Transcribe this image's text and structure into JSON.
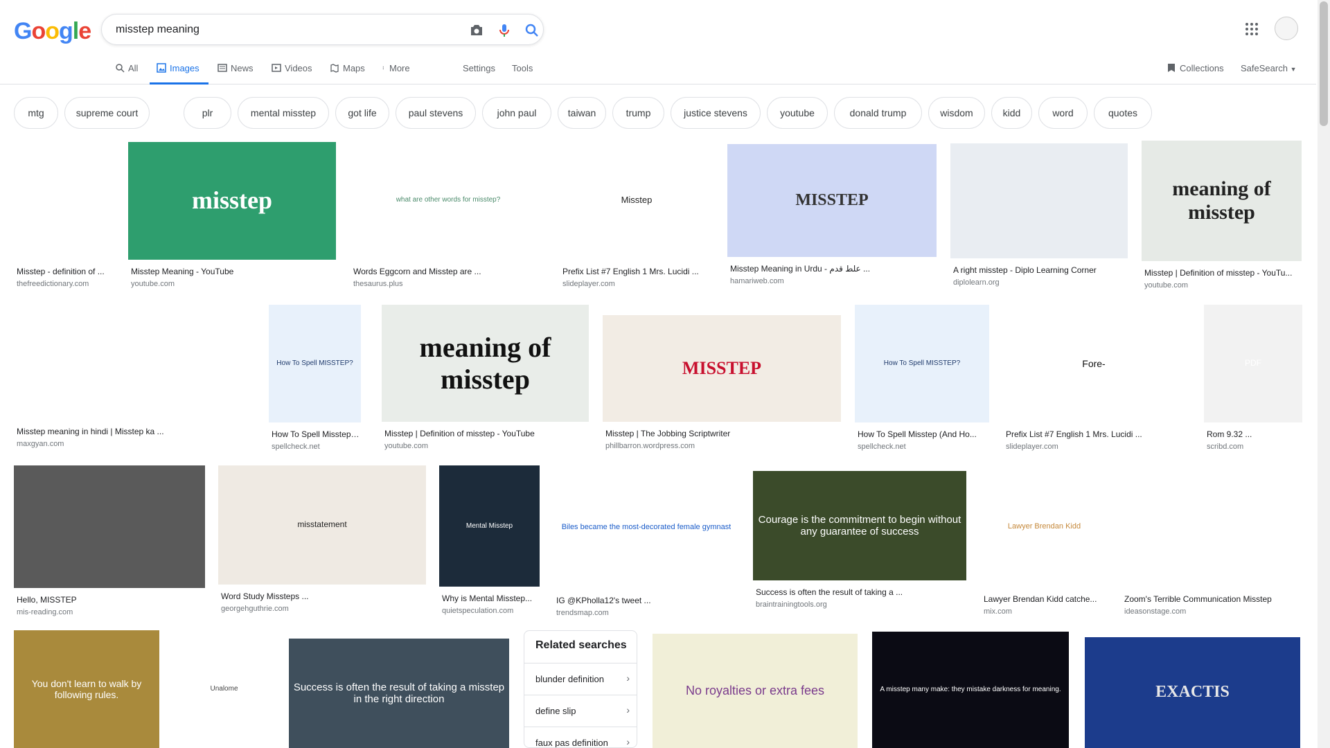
{
  "header": {
    "logo_letters": [
      "G",
      "o",
      "o",
      "g",
      "l",
      "e"
    ],
    "logo_colors": [
      "#4285f4",
      "#ea4335",
      "#fbbc05",
      "#4285f4",
      "#34a853",
      "#ea4335"
    ],
    "search_value": "misstep meaning"
  },
  "tabs": [
    {
      "label": "All",
      "icon": "search-icon"
    },
    {
      "label": "Images",
      "icon": "image-icon",
      "active": true
    },
    {
      "label": "News",
      "icon": "news-icon"
    },
    {
      "label": "Videos",
      "icon": "video-icon"
    },
    {
      "label": "Maps",
      "icon": "map-icon"
    },
    {
      "label": "More",
      "icon": "more-vert-icon"
    },
    {
      "label": "Settings"
    },
    {
      "label": "Tools"
    }
  ],
  "right_tools": {
    "collections": "Collections",
    "safesearch": "SafeSearch"
  },
  "chips": [
    "mtg",
    "supreme court",
    "plr",
    "mental misstep",
    "got life",
    "paul stevens",
    "john paul",
    "taiwan",
    "trump",
    "justice stevens",
    "youtube",
    "donald trump",
    "wisdom",
    "kidd",
    "word",
    "quotes"
  ],
  "results": [
    {
      "caption": "Misstep - definition of ...",
      "domain": "thefreedictionary.com",
      "thumb_text": ""
    },
    {
      "caption": "Misstep Meaning - YouTube",
      "domain": "youtube.com",
      "thumb_text": "misstep"
    },
    {
      "caption": "Words Eggcorn and Misstep are ...",
      "domain": "thesaurus.plus",
      "thumb_text": "what are other words for misstep?"
    },
    {
      "caption": "Prefix List #7 English 1 Mrs. Lucidi ...",
      "domain": "slideplayer.com",
      "thumb_text": "Misstep"
    },
    {
      "caption": "Misstep Meaning in Urdu - علط قدم ...",
      "domain": "hamariweb.com",
      "thumb_text": "MISSTEP"
    },
    {
      "caption": "A right misstep - Diplo Learning Corner",
      "domain": "diplolearn.org",
      "thumb_text": ""
    },
    {
      "caption": "Misstep | Definition of misstep - YouTu...",
      "domain": "youtube.com",
      "thumb_text": "meaning of misstep"
    },
    {
      "caption": "Misstep meaning in hindi | Misstep ka ...",
      "domain": "maxgyan.com",
      "thumb_text": ""
    },
    {
      "caption": "How To Spell Misstep (...",
      "domain": "spellcheck.net",
      "thumb_text": "How To Spell MISSTEP?"
    },
    {
      "caption": "Misstep | Definition of misstep - YouTube",
      "domain": "youtube.com",
      "thumb_text": "meaning of misstep"
    },
    {
      "caption": "Misstep | The Jobbing Scriptwriter",
      "domain": "phillbarron.wordpress.com",
      "thumb_text": "MISSTEP"
    },
    {
      "caption": "How To Spell Misstep (And Ho...",
      "domain": "spellcheck.net",
      "thumb_text": "How To Spell MISSTEP?"
    },
    {
      "caption": "Prefix List #7 English 1 Mrs. Lucidi ...",
      "domain": "slideplayer.com",
      "thumb_text": "Fore-"
    },
    {
      "caption": "Rom 9.32 ...",
      "domain": "scribd.com",
      "thumb_text": "PDF"
    },
    {
      "caption": "Hello, MISSTEP",
      "domain": "mis-reading.com",
      "thumb_text": ""
    },
    {
      "caption": "Word Study Missteps ...",
      "domain": "georgehguthrie.com",
      "thumb_text": "misstatement"
    },
    {
      "caption": "Why is Mental Missteр...",
      "domain": "quietspeculation.com",
      "thumb_text": "Mental Misstep"
    },
    {
      "caption": "IG @KPholla12's tweet ...",
      "domain": "trendsmap.com",
      "thumb_text": "Biles became the most-decorated female gymnast"
    },
    {
      "caption": "Success is often the result of taking a ...",
      "domain": "braintrainingtools.org",
      "thumb_text": "Courage is the commitment to begin without any guarantee of success"
    },
    {
      "caption": "Lawyer Brendan Kidd catche...",
      "domain": "mix.com",
      "thumb_text": "Lawyer Brendan Kidd"
    },
    {
      "caption": "Zoom's Terrible Communication Misstep",
      "domain": "ideasonstage.com",
      "thumb_text": ""
    },
    {
      "caption": "",
      "domain": "",
      "thumb_text": "You don't learn to walk by following rules."
    },
    {
      "caption": "",
      "domain": "",
      "thumb_text": "Unalome"
    },
    {
      "caption": "",
      "domain": "",
      "thumb_text": "Success is often the result of taking a misstep in the right direction"
    },
    {
      "caption": "",
      "domain": "",
      "thumb_text": "No royalties or extra fees"
    },
    {
      "caption": "",
      "domain": "",
      "thumb_text": "A misstep many make: they mistake darkness for meaning."
    },
    {
      "caption": "",
      "domain": "",
      "thumb_text": "EXACTIS"
    }
  ],
  "related": {
    "title": "Related searches",
    "items": [
      "blunder definition",
      "define slip",
      "faux pas definition"
    ]
  }
}
